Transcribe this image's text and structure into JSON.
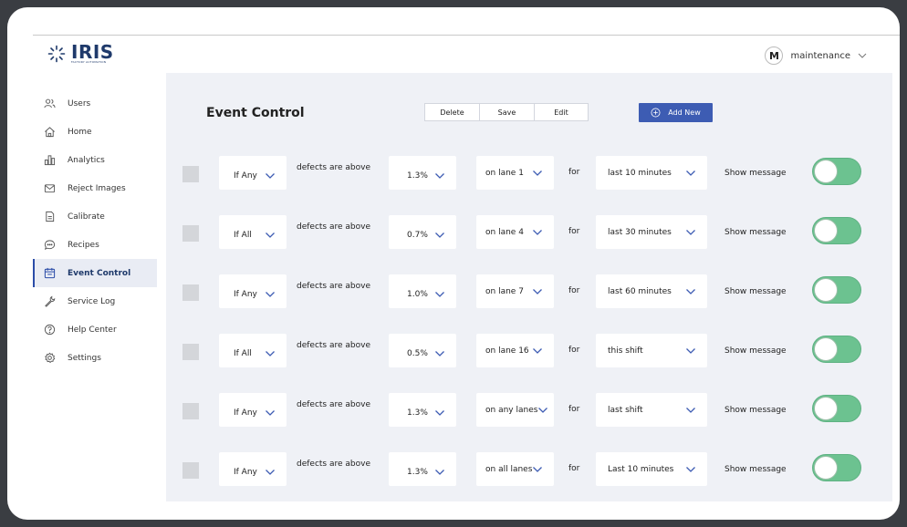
{
  "app": {
    "logo_text": "IRIS",
    "logo_subtext": "FACTORY AUTOMATION"
  },
  "user": {
    "initial": "M",
    "name": "maintenance"
  },
  "sidebar": {
    "items": [
      {
        "label": "Users",
        "icon": "users-icon"
      },
      {
        "label": "Home",
        "icon": "home-icon"
      },
      {
        "label": "Analytics",
        "icon": "analytics-icon"
      },
      {
        "label": "Reject Images",
        "icon": "mail-icon"
      },
      {
        "label": "Calibrate",
        "icon": "document-icon"
      },
      {
        "label": "Recipes",
        "icon": "chat-icon"
      },
      {
        "label": "Event Control",
        "icon": "calendar-icon",
        "active": true
      },
      {
        "label": "Service Log",
        "icon": "wrench-icon"
      },
      {
        "label": "Help Center",
        "icon": "help-icon"
      },
      {
        "label": "Settings",
        "icon": "gear-icon"
      }
    ]
  },
  "page": {
    "title": "Event Control",
    "toolbar": {
      "delete_label": "Delete",
      "save_label": "Save",
      "edit_label": "Edit",
      "add_label": "Add New"
    }
  },
  "rules": [
    {
      "condition": "If Any",
      "defects_label": "defects are above",
      "threshold": "1.3%",
      "lane": "on lane 1",
      "for_label": "for",
      "window": "last 10 minutes",
      "action": "Show message",
      "enabled": true
    },
    {
      "condition": "If All",
      "defects_label": "defects are above",
      "threshold": "0.7%",
      "lane": "on lane 4",
      "for_label": "for",
      "window": "last 30 minutes",
      "action": "Show message",
      "enabled": true
    },
    {
      "condition": "If Any",
      "defects_label": "defects are above",
      "threshold": "1.0%",
      "lane": "on lane 7",
      "for_label": "for",
      "window": "last 60 minutes",
      "action": "Show message",
      "enabled": true
    },
    {
      "condition": "If All",
      "defects_label": "defects are above",
      "threshold": "0.5%",
      "lane": "on lane 16",
      "for_label": "for",
      "window": "this shift",
      "action": "Show message",
      "enabled": true
    },
    {
      "condition": "If Any",
      "defects_label": "defects are above",
      "threshold": "1.3%",
      "lane": "on any lanes",
      "for_label": "for",
      "window": "last shift",
      "action": "Show message",
      "enabled": true
    },
    {
      "condition": "If Any",
      "defects_label": "defects are above",
      "threshold": "1.3%",
      "lane": "on all lanes",
      "for_label": "for",
      "window": "Last 10 minutes",
      "action": "Show message",
      "enabled": true
    }
  ],
  "colors": {
    "accent": "#3d5cb3",
    "toggle_on": "#6cc290",
    "content_bg": "#eff1f6"
  }
}
